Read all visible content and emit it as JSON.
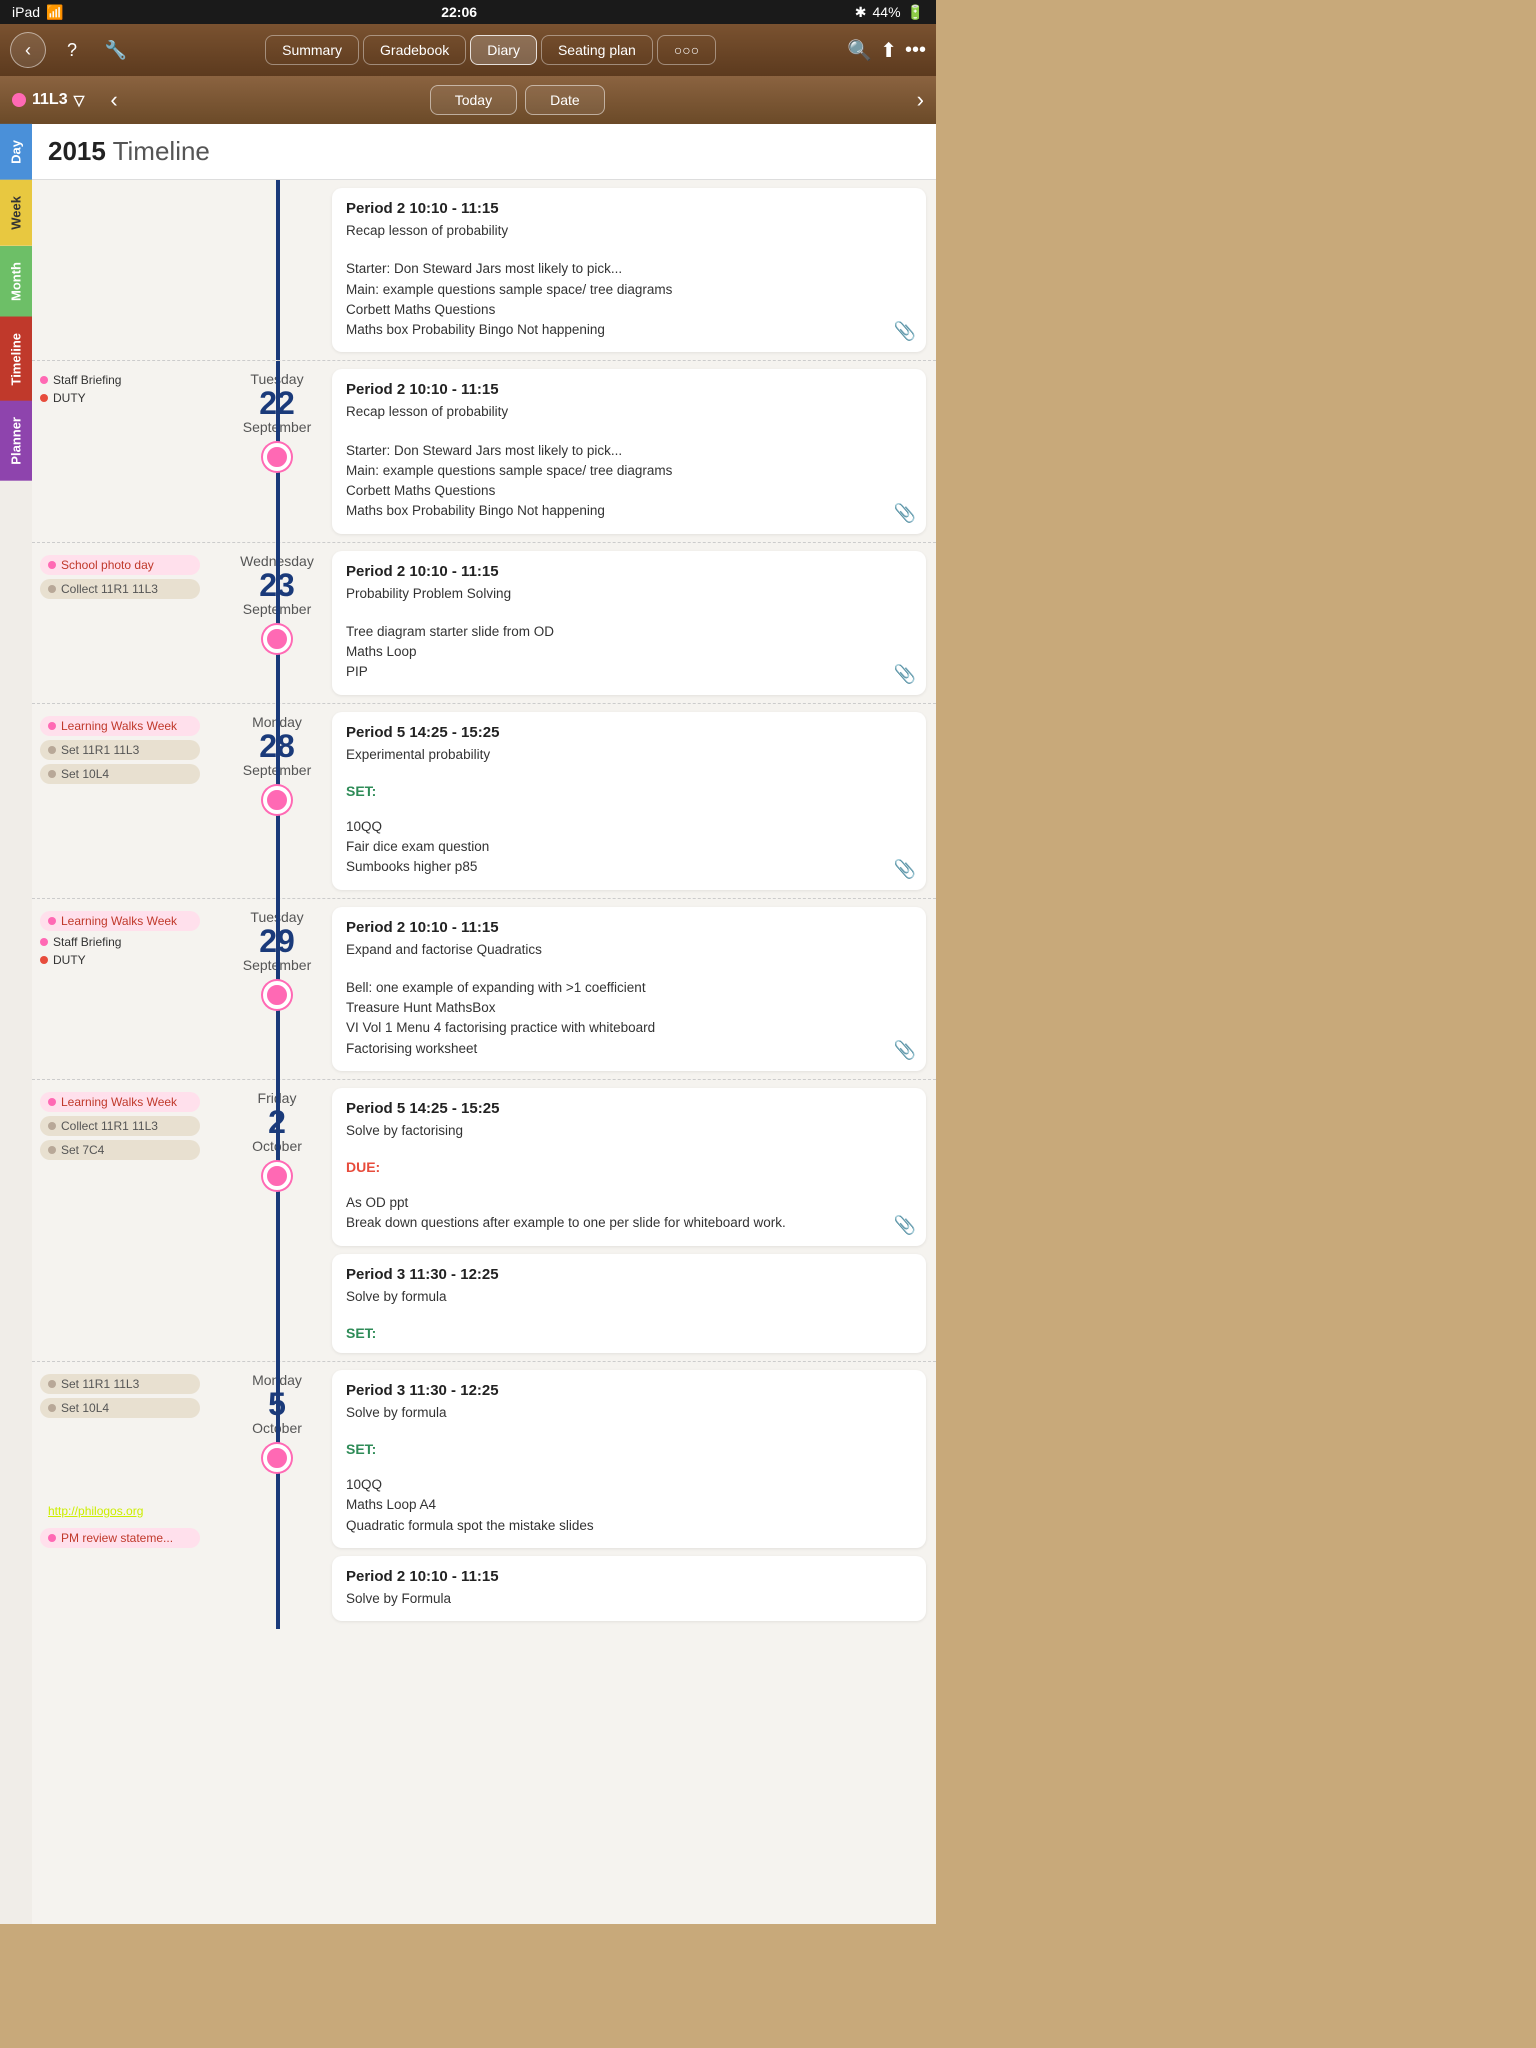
{
  "statusBar": {
    "left": "iPad",
    "wifi": "wifi",
    "time": "22:06",
    "bluetooth": "bluetooth",
    "battery": "44%"
  },
  "navTabs": [
    {
      "id": "summary",
      "label": "Summary",
      "active": false
    },
    {
      "id": "gradebook",
      "label": "Gradebook",
      "active": false
    },
    {
      "id": "diary",
      "label": "Diary",
      "active": true
    },
    {
      "id": "seating",
      "label": "Seating plan",
      "active": false
    },
    {
      "id": "more",
      "label": "○○○",
      "active": false
    }
  ],
  "classLabel": "11L3",
  "subNavBtns": [
    "Today",
    "Date"
  ],
  "yearLabel": "2015",
  "timelineLabel": "Timeline",
  "topCard": {
    "title": "Period 2   10:10 - 11:15",
    "subtitle": "Recap lesson of probability",
    "body": "Starter: Don Steward Jars most likely to pick...\nMain: example questions sample space/ tree diagrams\nCorbett Maths Questions\nMaths box Probability Bingo Not happening"
  },
  "rows": [
    {
      "dayName": "Tuesday",
      "dayNumber": "22",
      "month": "September",
      "leftEvents": [
        {
          "type": "pill-pink",
          "label": "Staff Briefing"
        },
        {
          "type": "dot-red",
          "label": "DUTY"
        }
      ],
      "cards": [
        {
          "title": "Period 2   10:10 - 11:15",
          "subtitle": "Recap lesson of probability",
          "body": "Starter: Don Steward Jars most likely to pick...\nMain: example questions sample space/ tree diagrams\nCorbett Maths Questions\nMaths box Probability Bingo Not happening",
          "hasClip": true
        }
      ]
    },
    {
      "dayName": "Wednesday",
      "dayNumber": "23",
      "month": "September",
      "leftEvents": [
        {
          "type": "pill-pink",
          "label": "School photo day"
        },
        {
          "type": "pill-tan",
          "label": "Collect 11R1 11L3"
        }
      ],
      "cards": [
        {
          "title": "Period 2   10:10 - 11:15",
          "subtitle": "Probability Problem Solving",
          "body": "Tree diagram starter slide from OD\nMaths Loop\nPIP",
          "hasClip": true
        }
      ]
    },
    {
      "dayName": "Monday",
      "dayNumber": "28",
      "month": "September",
      "leftEvents": [
        {
          "type": "pill-pink",
          "label": "Learning Walks Week"
        },
        {
          "type": "pill-tan",
          "label": "Set 11R1 11L3"
        },
        {
          "type": "pill-tan",
          "label": "Set 10L4"
        }
      ],
      "cards": [
        {
          "title": "Period 5   14:25 - 15:25",
          "subtitle": "Experimental probability",
          "setLabel": "SET:",
          "body": "10QQ\nFair dice exam question\nSumbooks higher p85",
          "hasClip": true
        }
      ]
    },
    {
      "dayName": "Tuesday",
      "dayNumber": "29",
      "month": "September",
      "leftEvents": [
        {
          "type": "pill-pink",
          "label": "Learning Walks Week"
        },
        {
          "type": "dot-pink",
          "label": "Staff Briefing"
        },
        {
          "type": "dot-red",
          "label": "DUTY"
        }
      ],
      "cards": [
        {
          "title": "Period 2   10:10 - 11:15",
          "subtitle": "Expand and factorise Quadratics",
          "body": "Bell: one example of expanding with >1 coefficient\nTreasure Hunt MathsBox\nVI Vol 1 Menu 4 factorising practice with whiteboard\nFactorising worksheet",
          "hasClip": true
        }
      ]
    },
    {
      "dayName": "Friday",
      "dayNumber": "2",
      "month": "October",
      "leftEvents": [
        {
          "type": "pill-pink",
          "label": "Learning Walks Week"
        },
        {
          "type": "pill-tan",
          "label": "Collect 11R1 11L3"
        },
        {
          "type": "pill-tan",
          "label": "Set 7C4"
        }
      ],
      "cards": [
        {
          "title": "Period 5   14:25 - 15:25",
          "subtitle": "Solve by factorising",
          "dueLabel": "DUE:",
          "body": "As OD ppt\nBreak down questions after example to one per slide for whiteboard work.",
          "hasClip": true
        },
        {
          "title": "Period 3   11:30 - 12:25",
          "subtitle": "Solve by formula",
          "setLabel": "SET:",
          "body": "",
          "hasClip": false
        }
      ]
    },
    {
      "dayName": "Monday",
      "dayNumber": "5",
      "month": "October",
      "leftEvents": [
        {
          "type": "pill-tan",
          "label": "Set 11R1 11L3"
        },
        {
          "type": "pill-tan",
          "label": "Set 10L4"
        }
      ],
      "cards": [
        {
          "title": "Period 3   11:30 - 12:25",
          "subtitle": "Solve by formula",
          "setLabel": "SET:",
          "body": "10QQ\nMaths Loop A4\nQuadratic formula spot the mistake slides",
          "hasClip": false
        },
        {
          "title": "Period 2   10:10 - 11:15",
          "subtitle": "Solve by Formula",
          "body": "",
          "hasClip": false
        }
      ]
    }
  ],
  "philogosLink": "http://philogos.org",
  "bottomEvent": {
    "type": "pill-pink",
    "label": "PM review stateme..."
  },
  "sidebarTabs": [
    "Day",
    "Week",
    "Month",
    "Timeline",
    "Planner"
  ]
}
